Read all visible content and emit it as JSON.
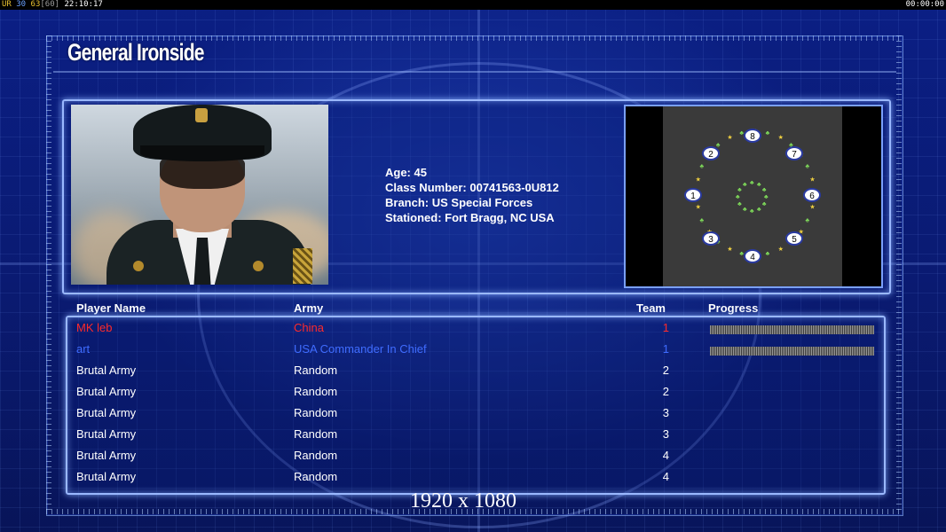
{
  "topbar": {
    "left": [
      {
        "text": "UR",
        "color": "#e8c030"
      },
      {
        "text": " 30 ",
        "color": "#6aa0ff"
      },
      {
        "text": "63",
        "color": "#e8c030"
      },
      {
        "text": "[60]",
        "color": "#999999"
      },
      {
        "text": " 22:10:17",
        "color": "#ffffff"
      }
    ],
    "right": "00:00:00"
  },
  "general": {
    "name": "General Ironside",
    "age": "Age: 45",
    "class_number": "Class Number: 00741563-0U812",
    "branch": "Branch: US Special Forces",
    "stationed": "Stationed: Fort Bragg, NC USA"
  },
  "map": {
    "start_positions": [
      {
        "label": "8"
      },
      {
        "label": "2"
      },
      {
        "label": "7"
      },
      {
        "label": "1"
      },
      {
        "label": "6"
      },
      {
        "label": "3"
      },
      {
        "label": "5"
      },
      {
        "label": "4"
      }
    ]
  },
  "table": {
    "headers": {
      "player": "Player Name",
      "army": "Army",
      "team": "Team",
      "progress": "Progress"
    },
    "rows": [
      {
        "name": "MK leb",
        "army": "China",
        "team": "1",
        "color": "#ff2a2a",
        "progress": true
      },
      {
        "name": "art",
        "army": "USA Commander In Chief",
        "team": "1",
        "color": "#3f6cff",
        "progress": true
      },
      {
        "name": "Brutal Army",
        "army": "Random",
        "team": "2",
        "color": "#ffffff",
        "progress": false
      },
      {
        "name": "Brutal Army",
        "army": "Random",
        "team": "2",
        "color": "#ffffff",
        "progress": false
      },
      {
        "name": "Brutal Army",
        "army": "Random",
        "team": "3",
        "color": "#ffffff",
        "progress": false
      },
      {
        "name": "Brutal Army",
        "army": "Random",
        "team": "3",
        "color": "#ffffff",
        "progress": false
      },
      {
        "name": "Brutal Army",
        "army": "Random",
        "team": "4",
        "color": "#ffffff",
        "progress": false
      },
      {
        "name": "Brutal Army",
        "army": "Random",
        "team": "4",
        "color": "#ffffff",
        "progress": false
      }
    ]
  },
  "resolution": "1920 x 1080"
}
